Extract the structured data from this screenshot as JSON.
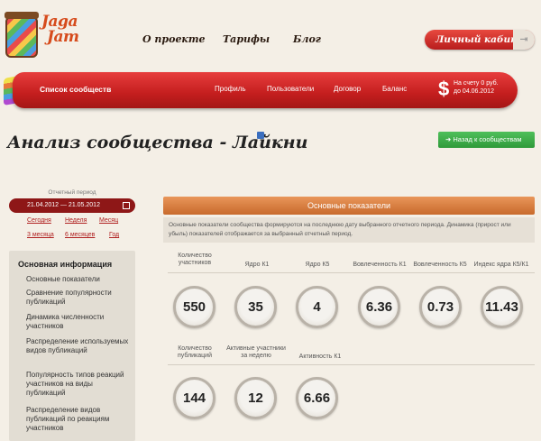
{
  "logo": {
    "brand_line1": "Jaga",
    "brand_line2": "Jam"
  },
  "topnav": [
    "О проекте",
    "Тарифы",
    "Блог"
  ],
  "cabinet": {
    "label": "Личный кабинет"
  },
  "nav": {
    "main": "Список сообществ",
    "items": [
      "Профиль",
      "Пользователи",
      "Договор",
      "Баланс"
    ],
    "account_line1": "На счету 0 руб.",
    "account_line2": "до 04.06.2012"
  },
  "page": {
    "title": "Анализ сообщества - Лайкни",
    "back_button": "Назад к сообществам"
  },
  "period": {
    "label": "Отчетный период",
    "range": "21.04.2012 — 21.05.2012",
    "links_row1": [
      "Сегодня",
      "Неделя",
      "Месяц"
    ],
    "links_row2": [
      "3 месяца",
      "6 месяцев",
      "Год"
    ]
  },
  "sidebar": {
    "heading": "Основная информация",
    "items": [
      "Основные показатели",
      "Сравнение популярности публикаций",
      "Динамика численности участников",
      "Распределение используемых видов публикаций",
      "Популярность типов реакций участников на виды публикаций",
      "Распределение видов публикаций по реакциям участников"
    ]
  },
  "main": {
    "section_title": "Основные показатели",
    "info_text": "Основные показатели сообщества формируются на последнюю дату выбранного отчетного периода. Динамика (прирост или убыль) показателей отображается за выбранный отчетный период.",
    "metrics_row1": [
      {
        "label": "Количество участников",
        "value": "550"
      },
      {
        "label": "Ядро К1",
        "value": "35"
      },
      {
        "label": "Ядро К5",
        "value": "4"
      },
      {
        "label": "Вовлеченность К1",
        "value": "6.36"
      },
      {
        "label": "Вовлеченность К5",
        "value": "0.73"
      },
      {
        "label": "Индекс ядра К5/К1",
        "value": "11.43"
      }
    ],
    "metrics_row2": [
      {
        "label": "Количество публикаций",
        "value": "144"
      },
      {
        "label": "Активные участники за неделю",
        "value": "12"
      },
      {
        "label": "Активность К1",
        "value": "6.66"
      }
    ]
  }
}
